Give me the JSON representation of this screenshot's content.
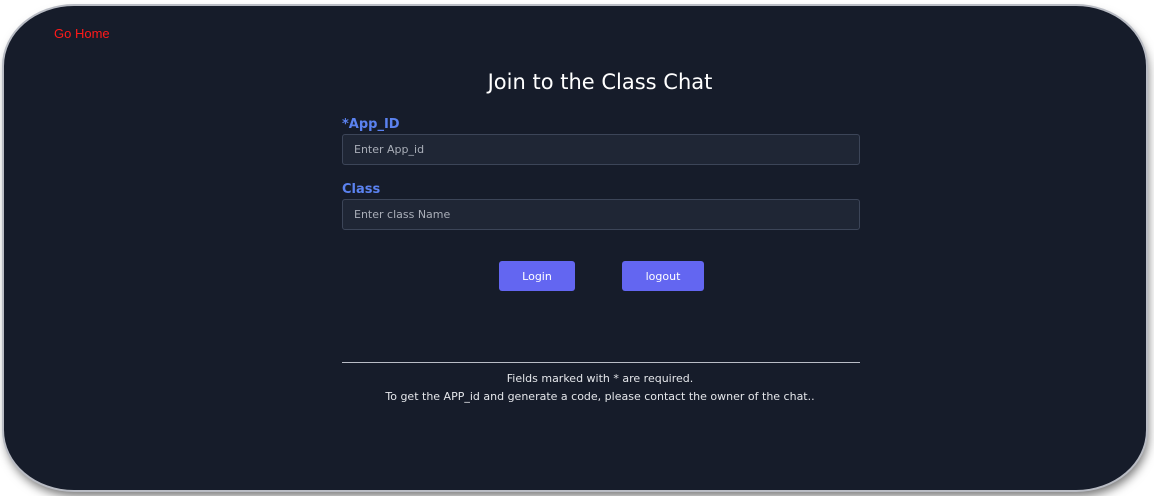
{
  "nav": {
    "go_home_label": "Go Home"
  },
  "form": {
    "title": "Join to the Class Chat",
    "app_id": {
      "label": "*App_ID",
      "placeholder": "Enter App_id",
      "value": ""
    },
    "class": {
      "label": "Class",
      "placeholder": "Enter class Name",
      "value": ""
    },
    "buttons": {
      "login_label": "Login",
      "logout_label": "logout"
    }
  },
  "footer": {
    "required_note": "Fields marked with * are required.",
    "contact_note": "To get the APP_id and generate a code, please contact the owner of the chat.."
  },
  "colors": {
    "background": "#161c2a",
    "accent_button": "#6366f1",
    "label_blue": "#5b82f0",
    "link_red": "#ff1a1a"
  }
}
